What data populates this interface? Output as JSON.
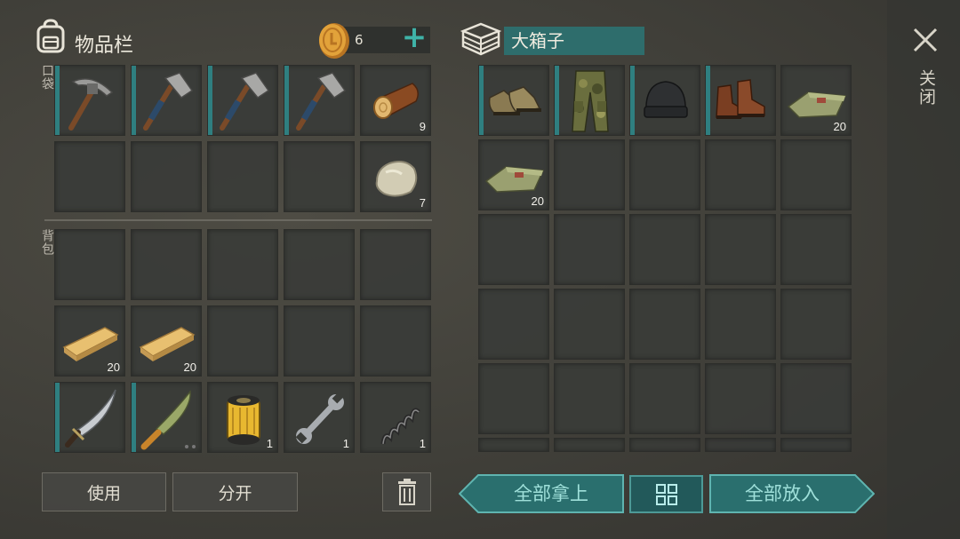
{
  "left_panel": {
    "title": "物品栏",
    "coins": "6",
    "add_label": "+",
    "pocket_label": "口袋",
    "backpack_label": "背包",
    "buttons": {
      "use": "使用",
      "split": "分开"
    }
  },
  "container": {
    "title": "大箱子",
    "buttons": {
      "take_all": "全部拿上",
      "put_all": "全部放入"
    }
  },
  "close_label": "关闭",
  "pocket": [
    {
      "item": "pickaxe-icon",
      "count": "",
      "equipped": true
    },
    {
      "item": "hatchet-icon",
      "count": "",
      "equipped": true
    },
    {
      "item": "hatchet-icon",
      "count": "",
      "equipped": true
    },
    {
      "item": "hatchet-icon",
      "count": "",
      "equipped": true
    },
    {
      "item": "log-icon",
      "count": "9",
      "equipped": false
    },
    {
      "item": "",
      "count": "",
      "equipped": false
    },
    {
      "item": "",
      "count": "",
      "equipped": false
    },
    {
      "item": "",
      "count": "",
      "equipped": false
    },
    {
      "item": "",
      "count": "",
      "equipped": false
    },
    {
      "item": "stone-icon",
      "count": "7",
      "equipped": false
    }
  ],
  "backpack": [
    {
      "item": "",
      "count": ""
    },
    {
      "item": "",
      "count": ""
    },
    {
      "item": "",
      "count": ""
    },
    {
      "item": "",
      "count": ""
    },
    {
      "item": "",
      "count": ""
    },
    {
      "item": "plank-icon",
      "count": "20"
    },
    {
      "item": "plank-icon",
      "count": "20"
    },
    {
      "item": "",
      "count": ""
    },
    {
      "item": "",
      "count": ""
    },
    {
      "item": "",
      "count": ""
    },
    {
      "item": "sword-icon",
      "count": "",
      "equipped": true
    },
    {
      "item": "machete-icon",
      "count": "",
      "equipped": true
    },
    {
      "item": "filter-icon",
      "count": "1"
    },
    {
      "item": "wrench-icon",
      "count": "1"
    },
    {
      "item": "spring-icon",
      "count": "1"
    }
  ],
  "chest": [
    {
      "item": "boots-icon",
      "count": "",
      "equipped": true
    },
    {
      "item": "camo-pants-icon",
      "count": "",
      "equipped": true
    },
    {
      "item": "beanie-icon",
      "count": "",
      "equipped": true
    },
    {
      "item": "leather-boots-icon",
      "count": "",
      "equipped": true
    },
    {
      "item": "cloth-icon",
      "count": "20"
    },
    {
      "item": "cloth-icon",
      "count": "20"
    }
  ],
  "colors": {
    "teal": "#2f7f80",
    "teal_light": "#5fb4b0",
    "coin": "#d9962f"
  }
}
